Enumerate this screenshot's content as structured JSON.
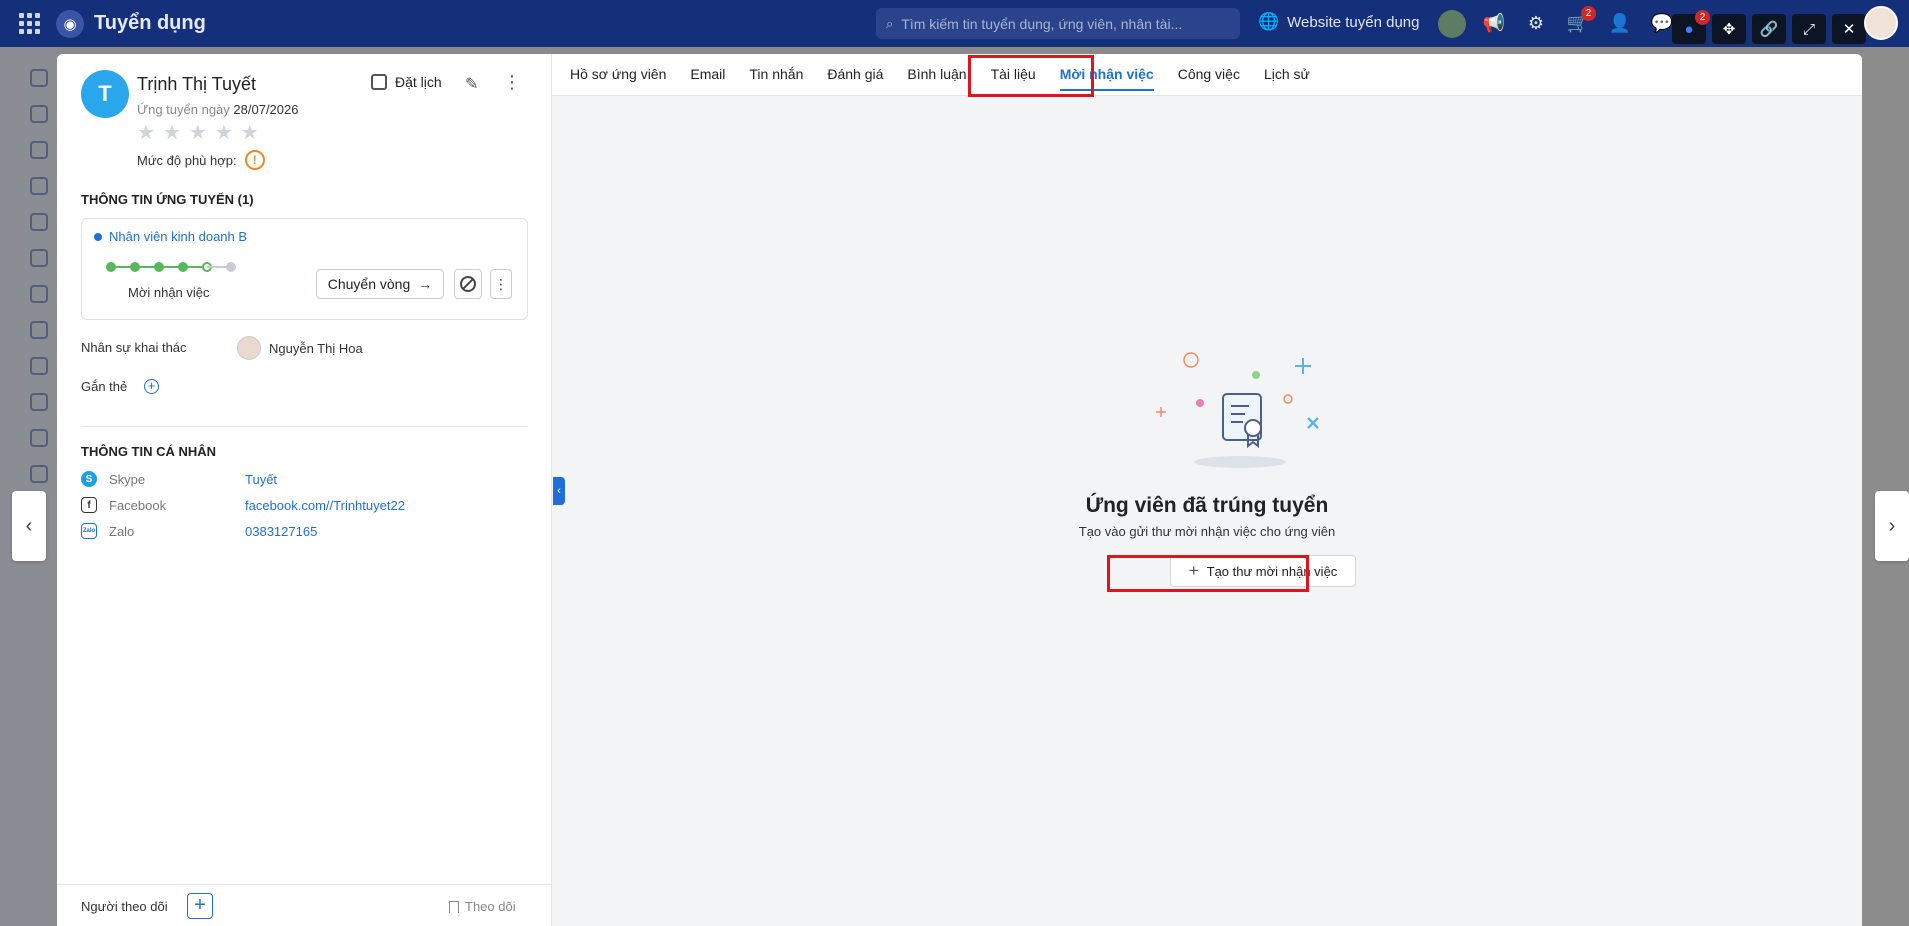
{
  "topbar": {
    "app_title": "Tuyển dụng",
    "search_placeholder": "Tìm kiếm tin tuyển dụng, ứng viên, nhân tài...",
    "website_label": "Website tuyển dụng",
    "cart_badge": "2",
    "chat_badge": "2"
  },
  "candidate": {
    "initial": "T",
    "name": "Trịnh Thị Tuyết",
    "applied_prefix": "Ứng tuyển ngày",
    "applied_date": "28/07/2026",
    "stars": [
      "★",
      "★",
      "★",
      "★",
      "★"
    ],
    "fit_label": "Mức độ phù hợp:",
    "schedule_label": "Đặt lịch"
  },
  "application": {
    "section_title": "THÔNG TIN ỨNG TUYỂN (1)",
    "job_title": "Nhân viên kinh doanh B",
    "stage_label": "Mời nhận việc",
    "move_button": "Chuyển vòng",
    "steps_total": 6,
    "steps_done": 5
  },
  "recruiter": {
    "label": "Nhân sự khai thác",
    "name": "Nguyễn Thị Hoa"
  },
  "tags_label": "Gắn thẻ",
  "personal": {
    "section_title": "THÔNG TIN CÁ NHÂN",
    "rows": [
      {
        "icon": "skype-icon",
        "label": "Skype",
        "value": "Tuyết",
        "color": "#1da1e6"
      },
      {
        "icon": "facebook-icon",
        "label": "Facebook",
        "value": "facebook.com//Trinhtuyet22",
        "color": "#333333"
      },
      {
        "icon": "zalo-icon",
        "label": "Zalo",
        "value": "0383127165",
        "color": "#1e6fd9"
      }
    ]
  },
  "footer": {
    "followers_label": "Người theo dõi",
    "follow_label": "Theo dõi"
  },
  "tabs": [
    "Hồ sơ ứng viên",
    "Email",
    "Tin nhắn",
    "Đánh giá",
    "Bình luận",
    "Tài liệu",
    "Mời nhận việc",
    "Công việc",
    "Lịch sử"
  ],
  "active_tab": "Mời nhận việc",
  "empty_state": {
    "title": "Ứng viên đã trúng tuyển",
    "subtitle": "Tạo vào gửi thư mời nhận việc cho ứng viên",
    "button": "Tạo thư mời nhận việc"
  },
  "colors": {
    "accent": "#1e6fd9",
    "topbar": "#15307a",
    "highlight": "#e0141b",
    "step_done": "#56b85a"
  }
}
